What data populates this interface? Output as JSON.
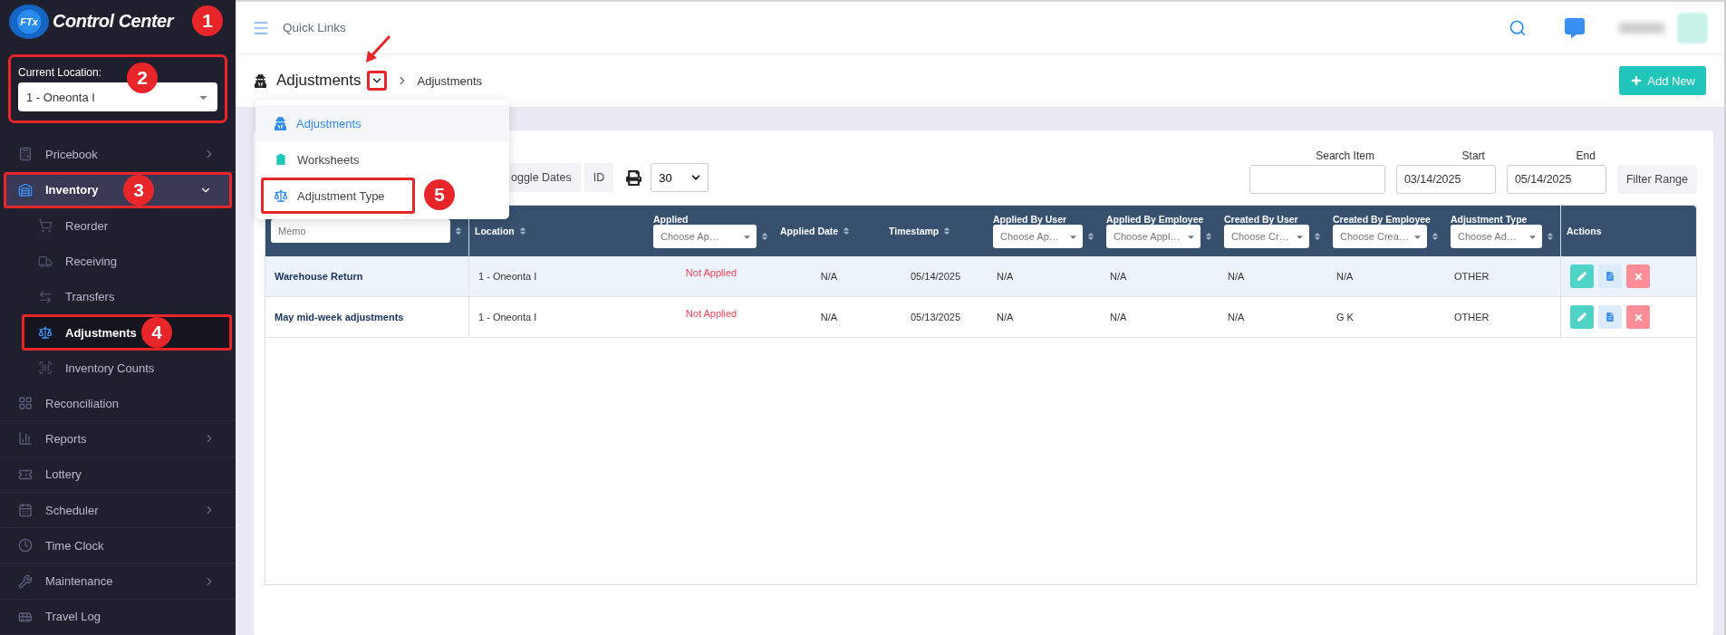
{
  "logo": {
    "badge": "FTx",
    "title": "Control Center",
    "callout": "1"
  },
  "location": {
    "label": "Current Location:",
    "value": "1 - Oneonta I",
    "callout": "2"
  },
  "sidebar": {
    "items": [
      {
        "label": "Pricebook",
        "expandable": true,
        "expanded": false
      },
      {
        "label": "Inventory",
        "expandable": true,
        "expanded": true,
        "callout": "3",
        "children": [
          {
            "label": "Reorder",
            "selected": false
          },
          {
            "label": "Receiving",
            "selected": false
          },
          {
            "label": "Transfers",
            "selected": false
          },
          {
            "label": "Adjustments",
            "selected": true,
            "callout": "4"
          },
          {
            "label": "Inventory Counts",
            "selected": false
          }
        ]
      },
      {
        "label": "Reconciliation",
        "expandable": false,
        "expanded": false
      },
      {
        "label": "Reports",
        "expandable": true,
        "expanded": false
      },
      {
        "label": "Lottery",
        "expandable": false,
        "expanded": false
      },
      {
        "label": "Scheduler",
        "expandable": true,
        "expanded": false
      },
      {
        "label": "Time Clock",
        "expandable": false,
        "expanded": false
      },
      {
        "label": "Maintenance",
        "expandable": true,
        "expanded": false
      },
      {
        "label": "Travel Log",
        "expandable": false,
        "expanded": false
      }
    ]
  },
  "topbar": {
    "quick_links": "Quick Links"
  },
  "page_header": {
    "title": "Adjustments",
    "breadcrumb": "Adjustments",
    "add_button": "Add New",
    "menu_open": true
  },
  "dropdown": {
    "items": [
      {
        "label": "Adjustments",
        "selected": true
      },
      {
        "label": "Worksheets",
        "selected": false
      },
      {
        "label": "Adjustment Type",
        "selected": false,
        "callout": "5"
      }
    ]
  },
  "toolbar": {
    "buttons": [
      "oggle Dates",
      "ID"
    ],
    "page_size": "30",
    "filters": [
      {
        "label": "Search Item"
      },
      {
        "label": "Start",
        "value": "03/14/2025"
      },
      {
        "label": "End",
        "value": "05/14/2025"
      }
    ],
    "filter_button": "Filter Range"
  },
  "table": {
    "columns": [
      {
        "kind": "input",
        "placeholder": "Memo",
        "sortable": true
      },
      {
        "kind": "plain",
        "label": "Location",
        "sortable": true
      },
      {
        "kind": "select",
        "label": "Applied",
        "placeholder": "Choose Ap…",
        "sortable": true
      },
      {
        "kind": "plain",
        "label": "Applied Date",
        "sortable": true
      },
      {
        "kind": "plain",
        "label": "Timestamp",
        "sortable": true
      },
      {
        "kind": "select",
        "label": "Applied By User",
        "placeholder": "Choose Ap…",
        "sortable": true
      },
      {
        "kind": "select",
        "label": "Applied By Employee",
        "placeholder": "Choose Appl…",
        "sortable": true
      },
      {
        "kind": "select",
        "label": "Created By User",
        "placeholder": "Choose Cr…",
        "sortable": true
      },
      {
        "kind": "select",
        "label": "Created By Employee",
        "placeholder": "Choose Crea…",
        "sortable": true
      },
      {
        "kind": "select",
        "label": "Adjustment Type",
        "placeholder": "Choose Ad…",
        "sortable": true
      },
      {
        "kind": "plain",
        "label": "Actions",
        "sortable": false
      }
    ],
    "rows": [
      {
        "selected": true,
        "memo": "Warehouse Return",
        "location": "1 - Oneonta I",
        "status": "Not Applied",
        "applied": false,
        "applied_date": "N/A",
        "timestamp": "05/14/2025",
        "applied_by_user": "N/A",
        "applied_by_employee": "N/A",
        "created_by_user": "N/A",
        "created_by_employee": "N/A",
        "adjustment_type": "OTHER"
      },
      {
        "selected": false,
        "memo": "May mid-week adjustments",
        "location": "1 - Oneonta I",
        "status": "Not Applied",
        "applied": false,
        "applied_date": "N/A",
        "timestamp": "05/13/2025",
        "applied_by_user": "N/A",
        "applied_by_employee": "N/A",
        "created_by_user": "N/A",
        "created_by_employee": "G K",
        "adjustment_type": "OTHER"
      }
    ]
  }
}
